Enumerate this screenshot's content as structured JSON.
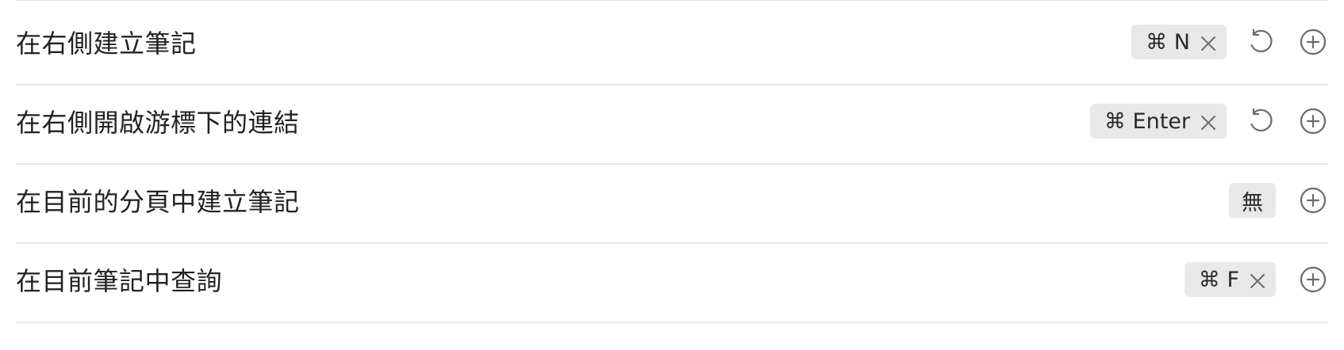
{
  "hotkeys": [
    {
      "label": "在右側建立筆記",
      "key": "⌘ N"
    },
    {
      "label": "在右側開啟游標下的連結",
      "key": "⌘ Enter"
    },
    {
      "label": "在目前的分頁中建立筆記",
      "key": "無"
    },
    {
      "label": "在目前筆記中查詢",
      "key": "⌘ F"
    }
  ],
  "colors": {
    "chip_background": "#e8e8e8",
    "divider": "#e6e6e6",
    "icon": "#6b6b6b"
  },
  "icons": [
    "close-icon",
    "reset-icon",
    "add-circle-icon"
  ]
}
